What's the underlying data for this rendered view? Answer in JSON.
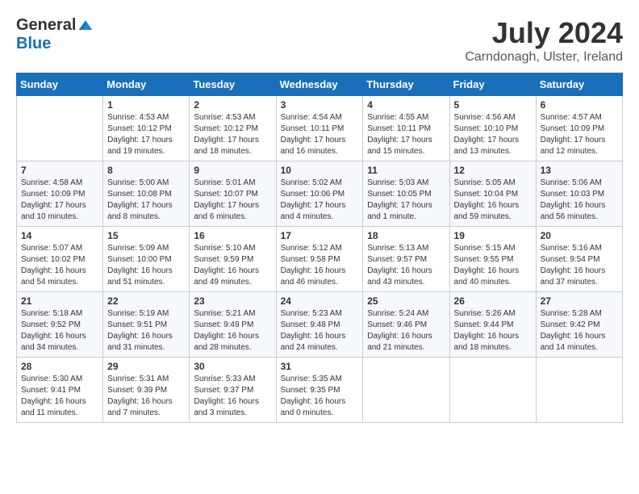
{
  "header": {
    "logo_general": "General",
    "logo_blue": "Blue",
    "month_year": "July 2024",
    "location": "Carndonagh, Ulster, Ireland"
  },
  "days_of_week": [
    "Sunday",
    "Monday",
    "Tuesday",
    "Wednesday",
    "Thursday",
    "Friday",
    "Saturday"
  ],
  "weeks": [
    [
      {
        "day": "",
        "info": ""
      },
      {
        "day": "1",
        "info": "Sunrise: 4:53 AM\nSunset: 10:12 PM\nDaylight: 17 hours\nand 19 minutes."
      },
      {
        "day": "2",
        "info": "Sunrise: 4:53 AM\nSunset: 10:12 PM\nDaylight: 17 hours\nand 18 minutes."
      },
      {
        "day": "3",
        "info": "Sunrise: 4:54 AM\nSunset: 10:11 PM\nDaylight: 17 hours\nand 16 minutes."
      },
      {
        "day": "4",
        "info": "Sunrise: 4:55 AM\nSunset: 10:11 PM\nDaylight: 17 hours\nand 15 minutes."
      },
      {
        "day": "5",
        "info": "Sunrise: 4:56 AM\nSunset: 10:10 PM\nDaylight: 17 hours\nand 13 minutes."
      },
      {
        "day": "6",
        "info": "Sunrise: 4:57 AM\nSunset: 10:09 PM\nDaylight: 17 hours\nand 12 minutes."
      }
    ],
    [
      {
        "day": "7",
        "info": "Sunrise: 4:58 AM\nSunset: 10:09 PM\nDaylight: 17 hours\nand 10 minutes."
      },
      {
        "day": "8",
        "info": "Sunrise: 5:00 AM\nSunset: 10:08 PM\nDaylight: 17 hours\nand 8 minutes."
      },
      {
        "day": "9",
        "info": "Sunrise: 5:01 AM\nSunset: 10:07 PM\nDaylight: 17 hours\nand 6 minutes."
      },
      {
        "day": "10",
        "info": "Sunrise: 5:02 AM\nSunset: 10:06 PM\nDaylight: 17 hours\nand 4 minutes."
      },
      {
        "day": "11",
        "info": "Sunrise: 5:03 AM\nSunset: 10:05 PM\nDaylight: 17 hours\nand 1 minute."
      },
      {
        "day": "12",
        "info": "Sunrise: 5:05 AM\nSunset: 10:04 PM\nDaylight: 16 hours\nand 59 minutes."
      },
      {
        "day": "13",
        "info": "Sunrise: 5:06 AM\nSunset: 10:03 PM\nDaylight: 16 hours\nand 56 minutes."
      }
    ],
    [
      {
        "day": "14",
        "info": "Sunrise: 5:07 AM\nSunset: 10:02 PM\nDaylight: 16 hours\nand 54 minutes."
      },
      {
        "day": "15",
        "info": "Sunrise: 5:09 AM\nSunset: 10:00 PM\nDaylight: 16 hours\nand 51 minutes."
      },
      {
        "day": "16",
        "info": "Sunrise: 5:10 AM\nSunset: 9:59 PM\nDaylight: 16 hours\nand 49 minutes."
      },
      {
        "day": "17",
        "info": "Sunrise: 5:12 AM\nSunset: 9:58 PM\nDaylight: 16 hours\nand 46 minutes."
      },
      {
        "day": "18",
        "info": "Sunrise: 5:13 AM\nSunset: 9:57 PM\nDaylight: 16 hours\nand 43 minutes."
      },
      {
        "day": "19",
        "info": "Sunrise: 5:15 AM\nSunset: 9:55 PM\nDaylight: 16 hours\nand 40 minutes."
      },
      {
        "day": "20",
        "info": "Sunrise: 5:16 AM\nSunset: 9:54 PM\nDaylight: 16 hours\nand 37 minutes."
      }
    ],
    [
      {
        "day": "21",
        "info": "Sunrise: 5:18 AM\nSunset: 9:52 PM\nDaylight: 16 hours\nand 34 minutes."
      },
      {
        "day": "22",
        "info": "Sunrise: 5:19 AM\nSunset: 9:51 PM\nDaylight: 16 hours\nand 31 minutes."
      },
      {
        "day": "23",
        "info": "Sunrise: 5:21 AM\nSunset: 9:49 PM\nDaylight: 16 hours\nand 28 minutes."
      },
      {
        "day": "24",
        "info": "Sunrise: 5:23 AM\nSunset: 9:48 PM\nDaylight: 16 hours\nand 24 minutes."
      },
      {
        "day": "25",
        "info": "Sunrise: 5:24 AM\nSunset: 9:46 PM\nDaylight: 16 hours\nand 21 minutes."
      },
      {
        "day": "26",
        "info": "Sunrise: 5:26 AM\nSunset: 9:44 PM\nDaylight: 16 hours\nand 18 minutes."
      },
      {
        "day": "27",
        "info": "Sunrise: 5:28 AM\nSunset: 9:42 PM\nDaylight: 16 hours\nand 14 minutes."
      }
    ],
    [
      {
        "day": "28",
        "info": "Sunrise: 5:30 AM\nSunset: 9:41 PM\nDaylight: 16 hours\nand 11 minutes."
      },
      {
        "day": "29",
        "info": "Sunrise: 5:31 AM\nSunset: 9:39 PM\nDaylight: 16 hours\nand 7 minutes."
      },
      {
        "day": "30",
        "info": "Sunrise: 5:33 AM\nSunset: 9:37 PM\nDaylight: 16 hours\nand 3 minutes."
      },
      {
        "day": "31",
        "info": "Sunrise: 5:35 AM\nSunset: 9:35 PM\nDaylight: 16 hours\nand 0 minutes."
      },
      {
        "day": "",
        "info": ""
      },
      {
        "day": "",
        "info": ""
      },
      {
        "day": "",
        "info": ""
      }
    ]
  ]
}
